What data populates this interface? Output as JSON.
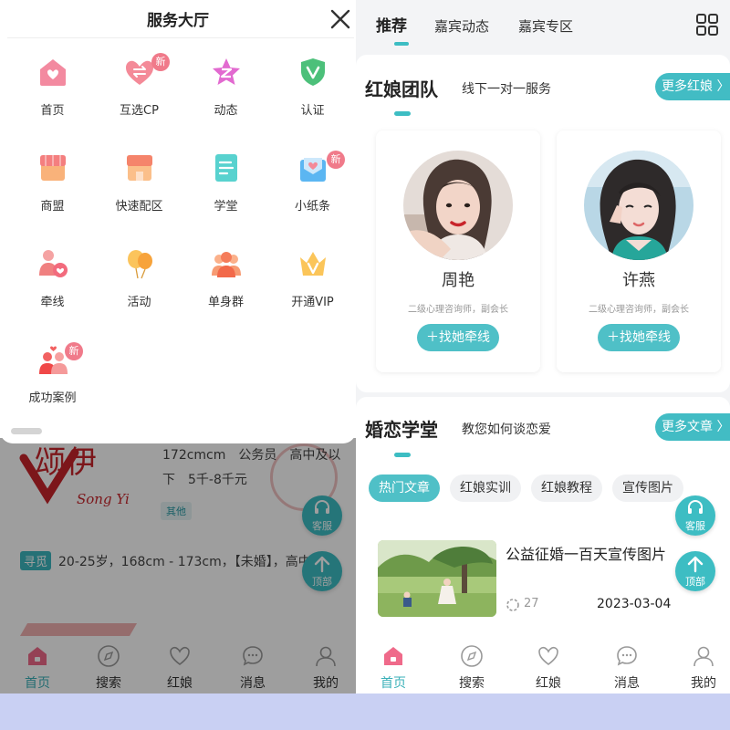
{
  "left": {
    "underlay": {
      "brand_cn": "颂伊",
      "brand_en": "Song Yi",
      "line1": "172cmcm　公务员　高中及以",
      "line2": "下　5千-8千元",
      "tag": "其他",
      "seek_label": "寻觅",
      "seek_text": "20-25岁，168cm - 173cm，【未婚】，高中"
    },
    "sheet": {
      "title": "服务大厅",
      "new_badge": "新",
      "services": [
        {
          "label": "首页",
          "icon": "home-icon",
          "new": false
        },
        {
          "label": "互选CP",
          "icon": "swap-heart-icon",
          "new": true
        },
        {
          "label": "动态",
          "icon": "star-z-icon",
          "new": false
        },
        {
          "label": "认证",
          "icon": "shield-check-icon",
          "new": false
        },
        {
          "label": "商盟",
          "icon": "shop-icon",
          "new": false
        },
        {
          "label": "快速配区",
          "icon": "store-icon",
          "new": false
        },
        {
          "label": "学堂",
          "icon": "document-icon",
          "new": false
        },
        {
          "label": "小纸条",
          "icon": "envelope-icon",
          "new": true
        },
        {
          "label": "牵线",
          "icon": "matchmaking-icon",
          "new": false
        },
        {
          "label": "活动",
          "icon": "balloons-icon",
          "new": false
        },
        {
          "label": "单身群",
          "icon": "group-icon",
          "new": false
        },
        {
          "label": "开通VIP",
          "icon": "vip-crown-icon",
          "new": false
        },
        {
          "label": "成功案例",
          "icon": "couple-icon",
          "new": true
        }
      ]
    },
    "fabs": {
      "service": "客服",
      "top": "顶部"
    },
    "bottom_nav": [
      "首页",
      "搜索",
      "红娘",
      "消息",
      "我的"
    ]
  },
  "right": {
    "tabs": [
      "推荐",
      "嘉宾动态",
      "嘉宾专区"
    ],
    "team": {
      "title": "红娘团队",
      "subtitle": "线下一对一服务",
      "more": "更多红娘 〉",
      "members": [
        {
          "name": "周艳",
          "role": "二级心理咨询师，副会长",
          "button": "＋找她牵线"
        },
        {
          "name": "许燕",
          "role": "二级心理咨询师，副会长",
          "button": "＋找她牵线"
        }
      ]
    },
    "school": {
      "title": "婚恋学堂",
      "subtitle": "教您如何谈恋爱",
      "more": "更多文章 〉",
      "chips": [
        "热门文章",
        "红娘实训",
        "红娘教程",
        "宣传图片"
      ],
      "article": {
        "title": "公益征婚一百天宣传图片",
        "views": "27",
        "date": "2023-03-04"
      }
    },
    "fabs": {
      "service": "客服",
      "top": "顶部"
    },
    "bottom_nav": [
      "首页",
      "搜索",
      "红娘",
      "消息",
      "我的"
    ]
  },
  "colors": {
    "accent": "#3dbdc3",
    "badge": "#f07a8a",
    "overlay": "rgba(0,0,0,0.38)",
    "outer_bg": "#c9d0f3"
  }
}
